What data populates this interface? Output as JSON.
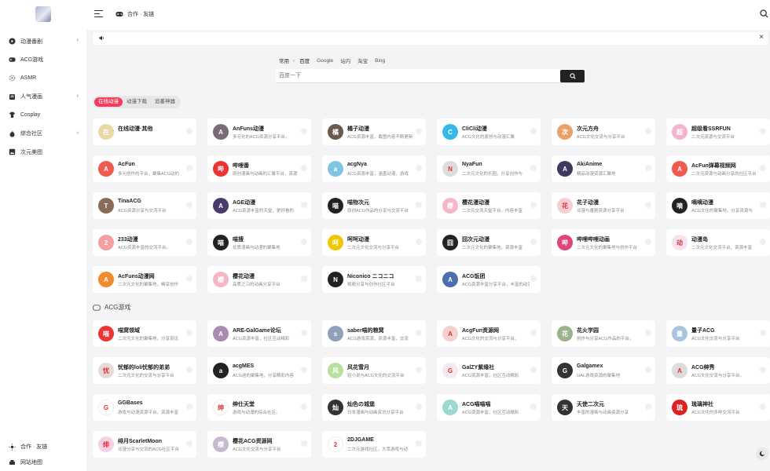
{
  "header": {
    "breadcrumb": "合作 · 友链"
  },
  "sidebar": {
    "items": [
      {
        "label": "动漫番剧",
        "icon": "play-circle-icon",
        "chevron": true
      },
      {
        "label": "ACG游戏",
        "icon": "gamepad-icon",
        "chevron": false
      },
      {
        "label": "ASMR",
        "icon": "gear-icon",
        "chevron": false
      },
      {
        "label": "人气漫画",
        "icon": "book-icon",
        "chevron": true
      },
      {
        "label": "Cosplay",
        "icon": "shirt-icon",
        "chevron": false
      },
      {
        "label": "综合社区",
        "icon": "fire-icon",
        "chevron": true
      },
      {
        "label": "次元美图",
        "icon": "image-icon",
        "chevron": false
      }
    ],
    "bottom": [
      {
        "label": "合作 · 友链",
        "icon": "sun-icon"
      },
      {
        "label": "网站地图",
        "icon": "printer-icon"
      }
    ]
  },
  "search": {
    "group": "常用",
    "engines": [
      "百度",
      "Google",
      "站内",
      "淘宝",
      "Bing"
    ],
    "active_engine": 0,
    "placeholder": "百度一下"
  },
  "filters": [
    "在线动漫",
    "动漫下载",
    "追番神器"
  ],
  "active_filter": 0,
  "sections": [
    {
      "title": "",
      "cards": [
        {
          "title": "在线动漫·其他",
          "desc": "",
          "icon": "anime-icon",
          "color": "#e9d9a0"
        },
        {
          "title": "AnFuns动漫",
          "desc": "多元化的ACG资源分享平台。",
          "icon": "anfuns-logo",
          "color": "#7b6b7a"
        },
        {
          "title": "橘子动漫",
          "desc": "ACG资源丰富，截图内容不断更新",
          "icon": "orange-logo",
          "color": "#6b5a50"
        },
        {
          "title": "CliCli动漫",
          "desc": "ACG文化的原创与动漫汇聚",
          "icon": "clicli-logo",
          "color": "#35b7e8"
        },
        {
          "title": "次元方舟",
          "desc": "ACG文化交流与分享平台",
          "icon": "ark-logo",
          "color": "#e6a26b"
        },
        {
          "title": "超级看SSRFUN",
          "desc": "二次元资源与交流平台",
          "icon": "ssrfun-logo",
          "color": "#f2b5d0"
        },
        {
          "title": "AcFun",
          "desc": "多元创作的平台，聚集ACG动的",
          "icon": "acfun-logo",
          "color": "#f05a4e"
        },
        {
          "title": "哔哩番",
          "desc": "原创漫画与动画的汇聚平台，资源",
          "icon": "bilifan-logo",
          "color": "#e33"
        },
        {
          "title": "acgNya",
          "desc": "ACG资源丰富，涵盖动漫、游戏",
          "icon": "acgnya-logo",
          "color": "#7fc4e2"
        },
        {
          "title": "NyaFun",
          "desc": "二次元文化的乐园，分享创作与",
          "icon": "nyafun-logo",
          "color": "#ddd"
        },
        {
          "title": "AkiAnime",
          "desc": "精品动漫资源汇聚地",
          "icon": "akianime-logo",
          "color": "#3e3a5e"
        },
        {
          "title": "AcFun弹幕视频网",
          "desc": "二次元资源与动画分享的社区平台",
          "icon": "acfun-logo",
          "color": "#f05a4e"
        },
        {
          "title": "TinaACG",
          "desc": "ACG资源分享与交流平台",
          "icon": "tina-logo",
          "color": "#8c6a58"
        },
        {
          "title": "AGE动漫",
          "desc": "ACG资源丰富的天堂，更好看的",
          "icon": "age-logo",
          "color": "#4b3a6e"
        },
        {
          "title": "喵物次元",
          "desc": "原创ACG作品的分享与交流平台",
          "icon": "cat-logo",
          "color": "#222"
        },
        {
          "title": "樱花漫动漫",
          "desc": "二次元交流天堂平台，内容丰富",
          "icon": "sakura-logo",
          "color": "#f7b6c6"
        },
        {
          "title": "花子动漫",
          "desc": "动漫与番剧资源分享平台",
          "icon": "hanako-logo",
          "color": "#f5cfd6"
        },
        {
          "title": "嘀嘀动漫",
          "desc": "ACG文化的聚集地，分享资源与",
          "icon": "globe-logo",
          "color": "#222"
        },
        {
          "title": "233动漫",
          "desc": "ACG资源丰富的交流平台。",
          "icon": "233-logo",
          "color": "#f3a0a0"
        },
        {
          "title": "喵搜",
          "desc": "优质漫画与动漫的聚集地",
          "icon": "globe-logo",
          "color": "#222"
        },
        {
          "title": "呵呵动漫",
          "desc": "二次元文化交流与分享平台",
          "icon": "hehe-logo",
          "color": "#f0c800"
        },
        {
          "title": "囧次元动漫",
          "desc": "二次元文化的聚集地，资源丰富",
          "icon": "jiong-logo",
          "color": "#222"
        },
        {
          "title": "哔哩哔哩动画",
          "desc": "二次元文化的聚集地与创作平台",
          "icon": "bilibili-logo",
          "color": "#e0457b"
        },
        {
          "title": "动漫岛",
          "desc": "二次元文化交流平台，资源丰富",
          "icon": "d-logo",
          "color": "#f7e2f0"
        },
        {
          "title": "AcFuns动漫网",
          "desc": "二次元文化的聚集地，畅享创作",
          "icon": "swirl-logo",
          "color": "#f28a2e"
        },
        {
          "title": "樱花动漫",
          "desc": "高质之习的动画分享平台",
          "icon": "sakura-logo",
          "color": "#f7b6c6"
        },
        {
          "title": "Niconico ニコニコ",
          "desc": "视频分享与创作社区平台",
          "icon": "niconico-logo",
          "color": "#222"
        },
        {
          "title": "ACG饭团",
          "desc": "ACG资源丰富分享平台，丰富的动漫",
          "icon": "fan-logo",
          "color": "#4b6fae"
        }
      ]
    },
    {
      "title": "ACG游戏",
      "cards": [
        {
          "title": "喵窝领域",
          "desc": "二次元文化的聚集地，分享资讯",
          "icon": "red-logo",
          "color": "#e33"
        },
        {
          "title": "ARE-GalGame论坛",
          "desc": "ACG资源丰富，社区互动精彩",
          "icon": "are-logo",
          "color": "#a98bb2"
        },
        {
          "title": "saber喵的粮窝",
          "desc": "ACG游戏资源，资源丰富，交流",
          "icon": "saber-logo",
          "color": "#8fa0b8"
        },
        {
          "title": "AcgFun资源网",
          "desc": "ACG文化的交流与分享平台。",
          "icon": "acgfun-logo",
          "color": "#f5d0d0"
        },
        {
          "title": "花火学园",
          "desc": "创作与分享ACG作品的平台。",
          "icon": "hanabi-logo",
          "color": "#9ab38a"
        },
        {
          "title": "量子ACG",
          "desc": "ACG文化交流与分享平台",
          "icon": "quantum-logo",
          "color": "#a9c4e0"
        },
        {
          "title": "忧郁的loli忧郁的弟弟",
          "desc": "二次元文化的交流与分享平台",
          "icon": "loli-logo",
          "color": "#e8d8d8"
        },
        {
          "title": "acgMES",
          "desc": "ACG迷的聚集地，分享精彩内容",
          "icon": "mes-logo",
          "color": "#222"
        },
        {
          "title": "风花雪月",
          "desc": "轻小说与ACG文化的交流平台",
          "icon": "fhxy-logo",
          "color": "#b8e0a0"
        },
        {
          "title": "GalZY紫缘社",
          "desc": "ACG资源丰富，社区互动精彩",
          "icon": "galzy-logo",
          "color": "#f5e8f0"
        },
        {
          "title": "Galgamex",
          "desc": "GAL游戏资源的聚集地",
          "icon": "galgamex-logo",
          "color": "#333"
        },
        {
          "title": "ACG绅秀",
          "desc": "ACG文化交流与分享平台。",
          "icon": "acgshen-logo",
          "color": "#dcdcdc"
        },
        {
          "title": "GGBases",
          "desc": "游戏与动漫资源平台，资源丰富",
          "icon": "ggbases-logo",
          "color": "#fff"
        },
        {
          "title": "绅仕天堂",
          "desc": "游戏与动漫的综合社区。",
          "icon": "google-logo",
          "color": "#fff"
        },
        {
          "title": "灿色の城堡",
          "desc": "日本漫画与动画资讯分享平台",
          "icon": "castle-logo",
          "color": "#333"
        },
        {
          "title": "ACG喵喵喵",
          "desc": "ACG资源丰富，社区互动精彩",
          "icon": "miku-logo",
          "color": "#9ad8d0"
        },
        {
          "title": "天使二次元",
          "desc": "丰富的漫画与动画资源分享",
          "icon": "wordpress-logo",
          "color": "#333"
        },
        {
          "title": "琉璃神社",
          "desc": "ACG文化的多样交流平台",
          "icon": "liuli-logo",
          "color": "#d22"
        },
        {
          "title": "绯月ScarletMoon",
          "desc": "动漫分享与交流的ACG社区平台",
          "icon": "moon-logo",
          "color": "#f7d0e6"
        },
        {
          "title": "樱花ACG资源网",
          "desc": "ACG文化交流与分享平台",
          "icon": "sakura-acg-logo",
          "color": "#c9b7d0"
        },
        {
          "title": "2DJGAME",
          "desc": "二次元游戏社区，大萃游戏与动",
          "icon": "2dj-logo",
          "color": "#fff"
        }
      ]
    }
  ]
}
